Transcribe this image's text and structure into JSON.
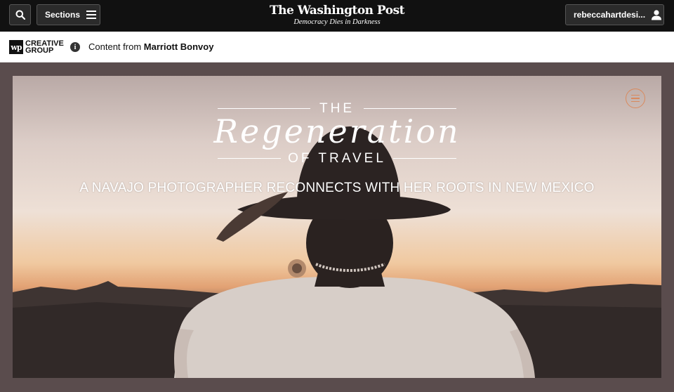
{
  "topnav": {
    "sections_label": "Sections",
    "masthead_title": "The Washington Post",
    "masthead_tagline": "Democracy Dies in Darkness",
    "username": "rebeccahartdesi..."
  },
  "sponsor": {
    "logo_mark": "wp",
    "logo_line1": "CREATIVE",
    "logo_line2": "GROUP",
    "content_from_prefix": "Content from",
    "sponsor_name": "Marriott Bonvoy"
  },
  "hero": {
    "title_the": "THE",
    "title_main": "Regeneration",
    "title_of": "OF TRAVEL",
    "subhead": "A NAVAJO PHOTOGRAPHER RECONNECTS WITH HER ROOTS IN NEW MEXICO",
    "accent_color": "#d98a5e"
  },
  "icons": [
    "search-icon",
    "hamburger-icon",
    "user-icon",
    "info-icon",
    "menu-icon"
  ]
}
